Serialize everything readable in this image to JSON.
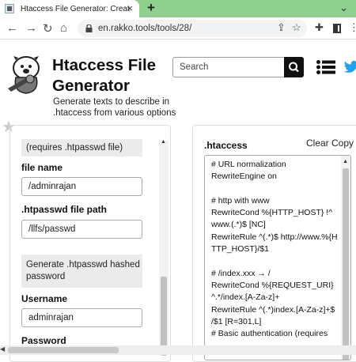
{
  "browser": {
    "tab_title": "Htaccess File Generator: Create ht",
    "tab_close": "×",
    "new_tab": "+",
    "url": "en.rakko.tools/tools/28/"
  },
  "header": {
    "title": "Htaccess File Generator",
    "description": "Generate texts to describe in .htaccess from various options",
    "search_placeholder": "Search"
  },
  "form": {
    "auth_box_text": "(requires .htpasswd file)",
    "file_name_label": "file name",
    "file_name_value": "/adminrajan",
    "htpasswd_path_label": ".htpasswd file path",
    "htpasswd_path_value": "/llfs/passwd",
    "generate_box_text": "Generate .htpasswd hashed password",
    "username_label": "Username",
    "username_value": "adminrajan",
    "password_label": "Password"
  },
  "output": {
    "label": ".htaccess",
    "clear_label": "Clear",
    "copy_label": "Copy",
    "lines": [
      "# URL normalization",
      "RewriteEngine on",
      "",
      "# http with www",
      "RewriteCond %{HTTP_HOST} !^www.(.*)$ [NC]",
      "RewriteRule ^(.*)$ http://www.%{HTTP_HOST}/$1",
      "",
      "# /index.xxx → /",
      "RewriteCond %{REQUEST_URI}^.*/index.[A-Za-z]+",
      "RewriteRule ^(.*)index.[A-Za-z]+$ /$1 [R=301,L]",
      "# Basic authentication (requires"
    ]
  },
  "icons": {
    "back": "arrow-left-icon",
    "forward": "arrow-right-icon",
    "reload": "reload-icon",
    "home": "home-icon",
    "lock": "lock-icon",
    "share": "share-icon",
    "bookmark": "star-icon",
    "extensions": "puzzle-icon",
    "menu": "hamburger-icon",
    "twitter": "twitter-icon"
  },
  "colors": {
    "tabbar": "#8fd08f",
    "twitter": "#1da1f2"
  }
}
